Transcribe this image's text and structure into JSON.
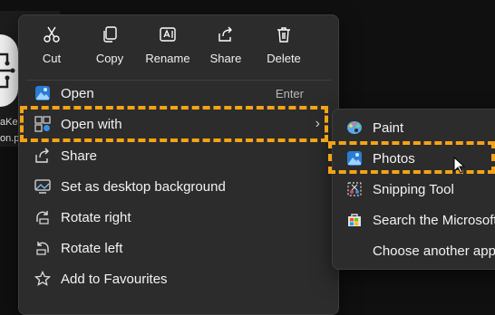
{
  "desktop": {
    "file_name_line1": "aKe",
    "file_name_line2": "on.p"
  },
  "toolbar": {
    "cut": "Cut",
    "copy": "Copy",
    "rename": "Rename",
    "share": "Share",
    "delete": "Delete"
  },
  "menu": {
    "open": "Open",
    "open_shortcut": "Enter",
    "open_with": "Open with",
    "share": "Share",
    "set_desktop_background": "Set as desktop background",
    "rotate_right": "Rotate right",
    "rotate_left": "Rotate left",
    "add_to_favourites": "Add to Favourites"
  },
  "submenu": {
    "paint": "Paint",
    "photos": "Photos",
    "snipping_tool": "Snipping Tool",
    "search_store": "Search the Microsoft",
    "choose_another": "Choose another app"
  },
  "colors": {
    "menu_bg": "#2c2c2c",
    "highlight": "#f5a316",
    "accent_blue": "#3a8ee6"
  },
  "icons": [
    "scissors-icon",
    "copy-icon",
    "rename-icon",
    "share-icon",
    "trash-icon",
    "photos-app-icon",
    "open-with-icon",
    "share-icon",
    "wallpaper-icon",
    "rotate-right-icon",
    "rotate-left-icon",
    "star-icon",
    "chevron-right-icon",
    "paint-app-icon",
    "snipping-tool-icon",
    "store-icon",
    "mouse-cursor-icon"
  ]
}
